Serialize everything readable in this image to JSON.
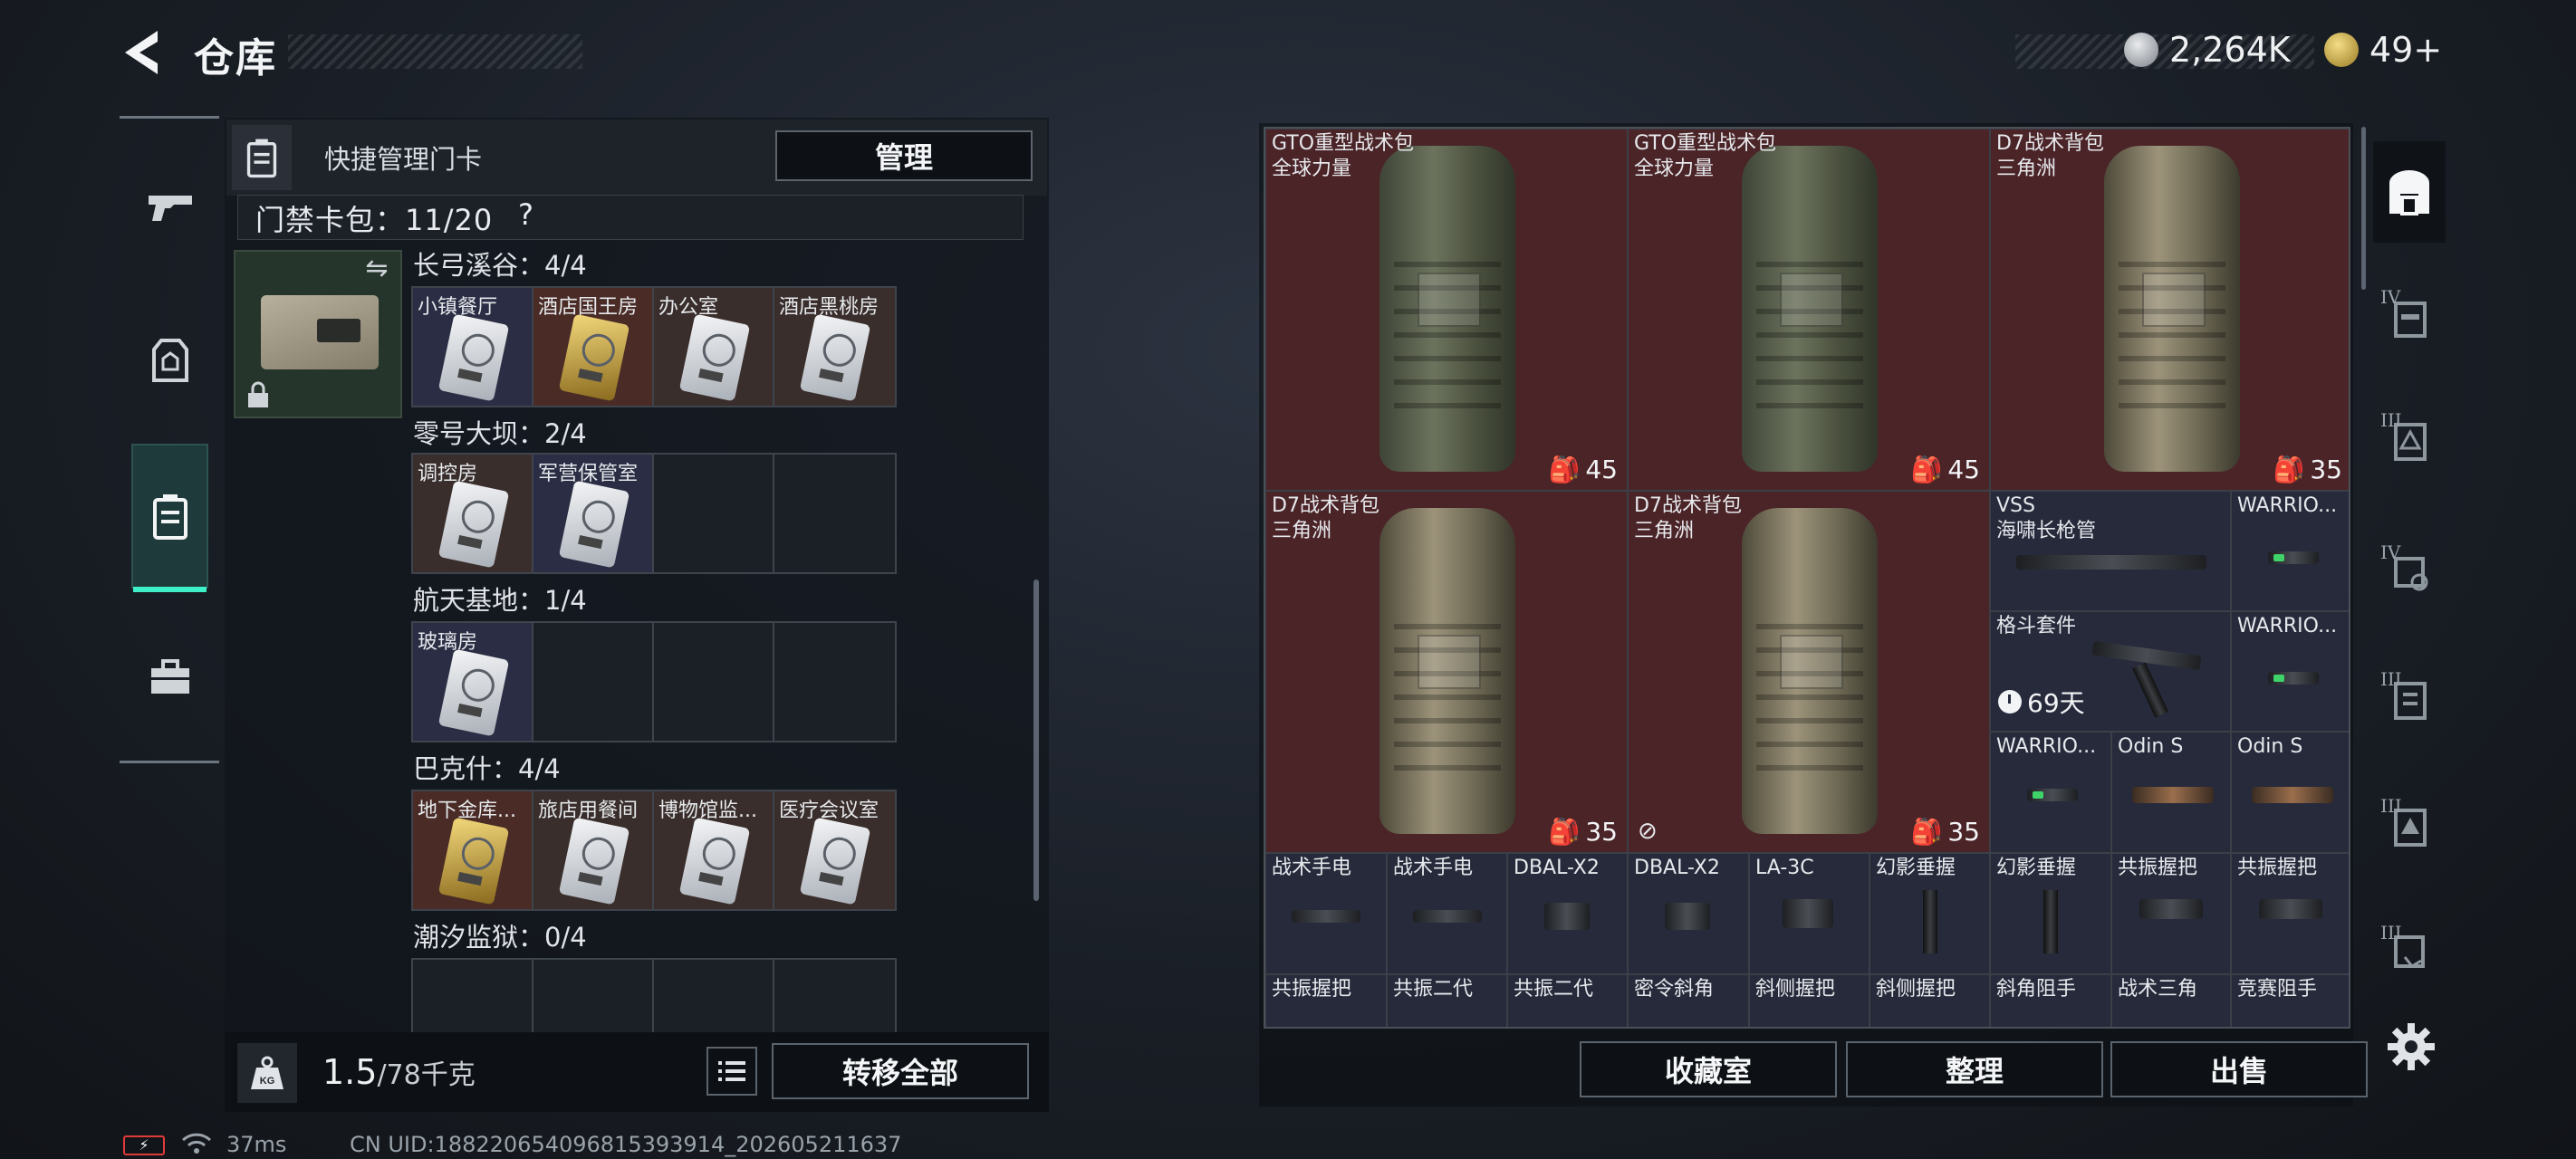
{
  "header": {
    "title": "仓库",
    "currency": [
      {
        "icon": "silver-coin-icon",
        "value": "2,264K"
      },
      {
        "icon": "gold-coin-icon",
        "value": "49+"
      }
    ]
  },
  "rail": {
    "tabs": [
      {
        "name": "weapons",
        "icon": "pistol-icon"
      },
      {
        "name": "gear",
        "icon": "vest-icon"
      },
      {
        "name": "keycards",
        "icon": "keycard-holder-icon",
        "active": true
      },
      {
        "name": "toolbox",
        "icon": "toolbox-icon"
      }
    ]
  },
  "quick": {
    "label": "快捷管理门卡",
    "manage": "管理",
    "wallet_label": "门禁卡包：11/20",
    "help": "?"
  },
  "groups": [
    {
      "label": "长弓溪谷：4/4",
      "slots": [
        "小镇餐厅",
        "酒店国王房",
        "办公室",
        "酒店黑桃房"
      ]
    },
    {
      "label": "零号大坝：2/4",
      "slots": [
        "调控房",
        "军营保管室"
      ]
    },
    {
      "label": "航天基地：1/4",
      "slots": [
        "玻璃房"
      ]
    },
    {
      "label": "巴克什：4/4",
      "slots": [
        "地下金库...",
        "旅店用餐间",
        "博物馆监...",
        "医疗会议室"
      ]
    },
    {
      "label": "潮汐监狱：0/4",
      "slots": []
    }
  ],
  "bottom": {
    "weight_value": "1.5",
    "weight_max": "/78千克",
    "transfer_all": "转移全部"
  },
  "status": {
    "ping": "37ms",
    "uid": "CN UID:18822065409681539391​4_202605211637"
  },
  "stash": {
    "bags": [
      {
        "name": "GTO重型战术包",
        "sub": "全球力量",
        "capacity": "45"
      },
      {
        "name": "GTO重型战术包",
        "sub": "全球力量",
        "capacity": "45"
      },
      {
        "name": "D7战术背包",
        "sub": "三角洲",
        "capacity": "35"
      },
      {
        "name": "D7战术背包",
        "sub": "三角洲",
        "capacity": "35"
      },
      {
        "name": "D7战术背包",
        "sub": "三角洲",
        "capacity": "35"
      }
    ],
    "vss": {
      "name": "VSS",
      "sub": "海啸长枪管"
    },
    "kit": {
      "name": "格斗套件",
      "timer": "69天"
    },
    "warrior_1": "WARRIO...",
    "warrior_2": "WARRIO...",
    "warrior_3": "WARRIO...",
    "odin_1": "Odin S",
    "odin_2": "Odin S",
    "row5": [
      "战术手电",
      "战术手电",
      "DBAL-X2",
      "DBAL-X2",
      "LA-3C",
      "幻影垂握",
      "幻影垂握",
      "共振握把",
      "共振握把"
    ],
    "row6": [
      "共振握把",
      "共振二代",
      "共振二代",
      "密令斜角",
      "斜侧握把",
      "斜侧握把",
      "斜角阻手",
      "战术三角",
      "竞赛阻手"
    ]
  },
  "actions": {
    "collection": "收藏室",
    "sort": "整理",
    "sell": "出售"
  },
  "filters": [
    {
      "icon": "bag-filter-icon",
      "level": ""
    },
    {
      "icon": "backpack-filter-icon",
      "level": "IV"
    },
    {
      "icon": "armor-filter-icon",
      "level": "III"
    },
    {
      "icon": "helmet-filter-icon",
      "level": "IV"
    },
    {
      "icon": "vest-filter-icon",
      "level": "III"
    },
    {
      "icon": "plate-filter-icon",
      "level": "III"
    },
    {
      "icon": "rig-filter-icon",
      "level": "III"
    }
  ]
}
